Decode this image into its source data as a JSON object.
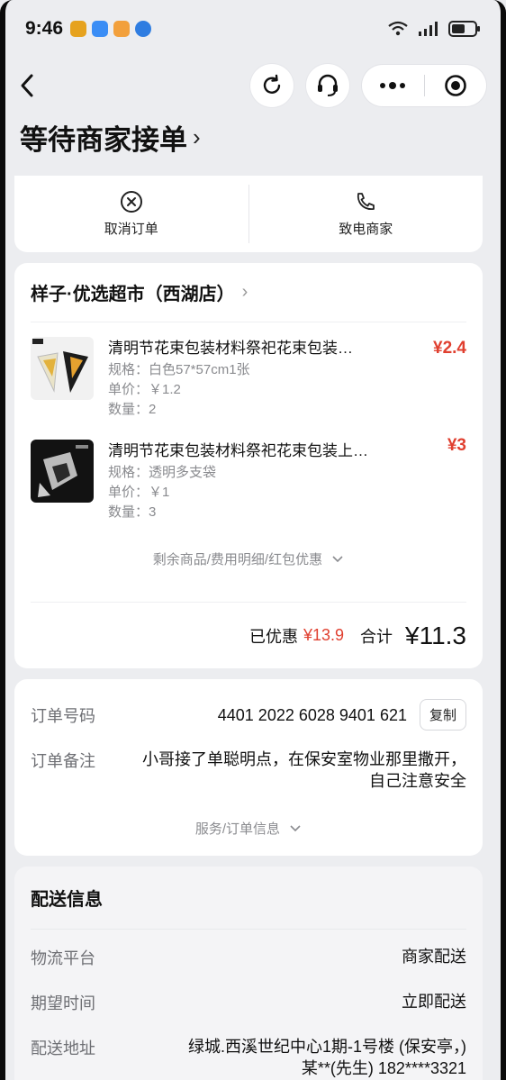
{
  "status_bar": {
    "time": "9:46",
    "app_icons": [
      "#e6a21e",
      "#3a8df5",
      "#f2a03c",
      "#2f7de1"
    ]
  },
  "nav": {
    "back_icon": "chevron-left-icon",
    "refresh_icon": "refresh-icon",
    "service_icon": "headset-icon",
    "more_icon": "more-icon",
    "close_icon": "target-icon"
  },
  "page": {
    "title": "等待商家接单",
    "title_chevron": "›"
  },
  "actions": {
    "cancel_label": "取消订单",
    "call_label": "致电商家"
  },
  "store": {
    "name": "样子·优选超市（西湖店）",
    "chevron": "›"
  },
  "items": [
    {
      "title": "清明节花束包装材料祭祀花束包装…",
      "spec": "规格：白色57*57cm1张",
      "unit_price": "单价：￥1.2",
      "quantity": "数量：2",
      "price": "¥2.4"
    },
    {
      "title": "清明节花束包装材料祭祀花束包装上…",
      "spec": "规格：透明多支袋",
      "unit_price": "单价：￥1",
      "quantity": "数量：3",
      "price": "¥3"
    }
  ],
  "more_link": "剩余商品/费用明细/红包优惠",
  "summary": {
    "discount_label": "已优惠",
    "discount_value": "¥13.9",
    "total_label": "合计",
    "total_value": "¥11.3"
  },
  "order": {
    "number_label": "订单号码",
    "number_value": "4401 2022 6028 9401 621",
    "copy_label": "复制",
    "note_label": "订单备注",
    "note_value": "小哥接了单聪明点，在保安室物业那里撒开，自己注意安全",
    "more_link": "服务/订单信息"
  },
  "delivery": {
    "title": "配送信息",
    "platform_label": "物流平台",
    "platform_value": "商家配送",
    "time_label": "期望时间",
    "time_value": "立即配送",
    "address_label": "配送地址",
    "address_line1": "绿城.西溪世纪中心1期-1号楼 (保安亭，)",
    "address_line2": "某**(先生) 182****3321"
  },
  "colors": {
    "accent_red": "#e03f2f",
    "background": "#ecedf0"
  }
}
